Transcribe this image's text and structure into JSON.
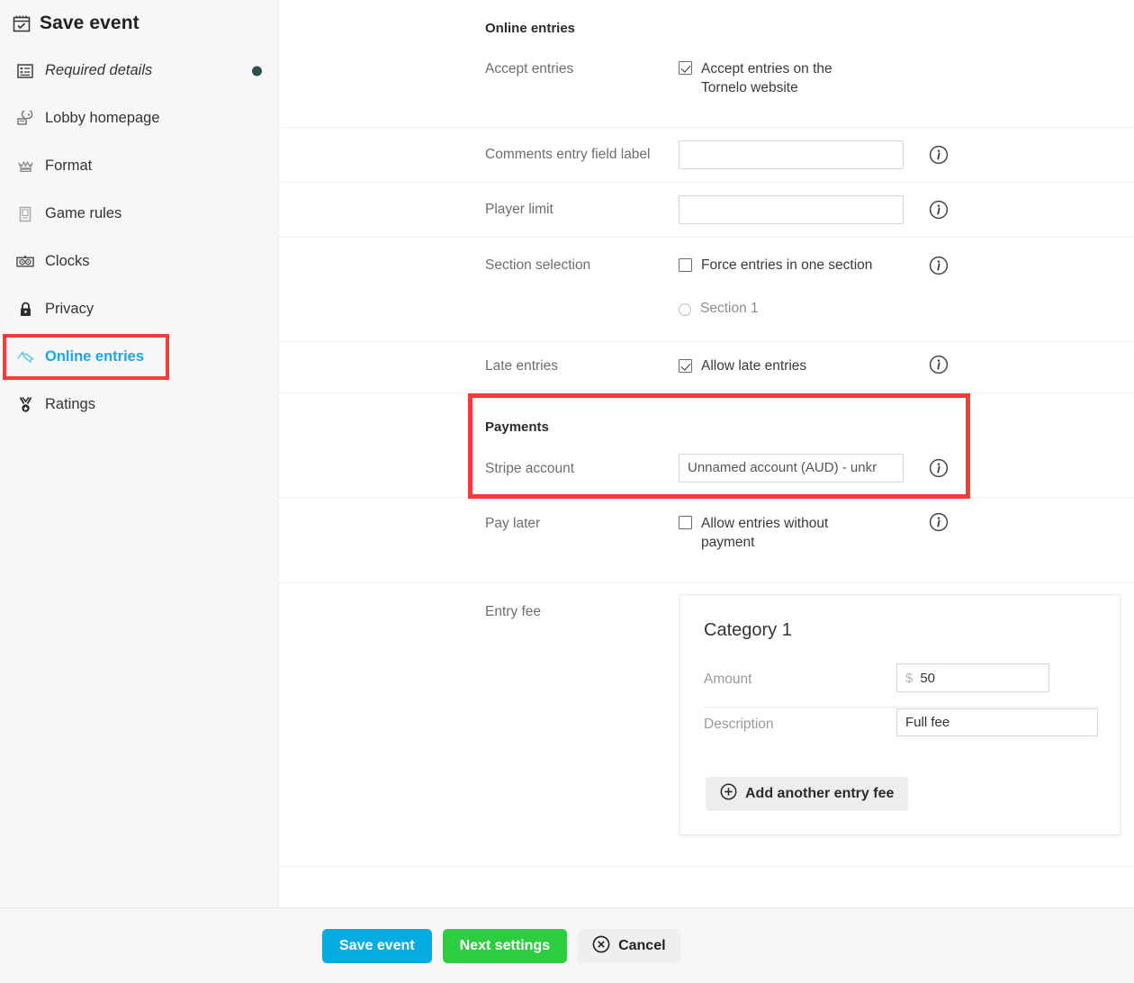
{
  "sidebar": {
    "header": {
      "title": "Save event",
      "icon": "calendar-check-icon"
    },
    "items": [
      {
        "label": "Required details",
        "icon": "form-list-icon",
        "italic": true,
        "active": false,
        "dot": true
      },
      {
        "label": "Lobby homepage",
        "icon": "lobby-presentation-icon",
        "italic": false,
        "active": false,
        "dot": false
      },
      {
        "label": "Format",
        "icon": "format-crown-icon",
        "italic": false,
        "active": false,
        "dot": false
      },
      {
        "label": "Game rules",
        "icon": "game-rules-book-icon",
        "italic": false,
        "active": false,
        "dot": false
      },
      {
        "label": "Clocks",
        "icon": "chess-clock-icon",
        "italic": false,
        "active": false,
        "dot": false
      },
      {
        "label": "Privacy",
        "icon": "padlock-icon",
        "italic": false,
        "active": false,
        "dot": false
      },
      {
        "label": "Online entries",
        "icon": "ticket-icon",
        "italic": false,
        "active": true,
        "dot": false
      },
      {
        "label": "Ratings",
        "icon": "medal-icon",
        "italic": false,
        "active": false,
        "dot": false
      }
    ]
  },
  "main": {
    "section_title": "Online entries",
    "payments_title": "Payments",
    "rows": {
      "accept_entries": {
        "label": "Accept entries",
        "checkbox_label": "Accept entries on the Tornelo website",
        "checked": true
      },
      "comments_field": {
        "label": "Comments entry field label",
        "value": "",
        "has_info": true
      },
      "player_limit": {
        "label": "Player limit",
        "value": "",
        "has_info": true
      },
      "section_selection": {
        "label": "Section selection",
        "checkbox_label": "Force entries in one section",
        "checked": false,
        "radio_label": "Section 1",
        "radio_selected": false,
        "has_info": true
      },
      "late_entries": {
        "label": "Late entries",
        "checkbox_label": "Allow late entries",
        "checked": true,
        "has_info": true
      },
      "stripe_account": {
        "label": "Stripe account",
        "value": "Unnamed account (AUD) - unkr",
        "has_info": true
      },
      "pay_later": {
        "label": "Pay later",
        "checkbox_label": "Allow entries without payment",
        "checked": false,
        "has_info": true
      },
      "entry_fee": {
        "label": "Entry fee"
      }
    },
    "fee_card": {
      "title": "Category 1",
      "amount_label": "Amount",
      "currency_symbol": "$",
      "amount_value": "50",
      "description_label": "Description",
      "description_value": "Full fee",
      "add_button_label": "Add another entry fee"
    }
  },
  "footer": {
    "save_label": "Save event",
    "next_label": "Next settings",
    "cancel_label": "Cancel"
  },
  "colors": {
    "highlight_red": "#f93a3a",
    "active_link": "#18a8e8",
    "save_blue": "#05ace0",
    "next_green": "#2ecc40",
    "status_dot": "#2f4f4f"
  }
}
